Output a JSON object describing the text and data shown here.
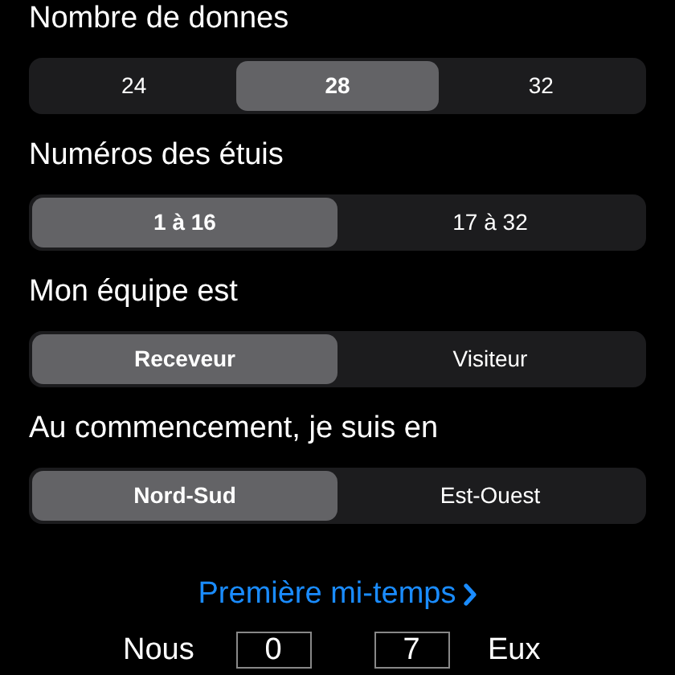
{
  "sections": [
    {
      "label": "Nombre de donnes",
      "options": [
        {
          "label": "24",
          "selected": false
        },
        {
          "label": "28",
          "selected": true
        },
        {
          "label": "32",
          "selected": false
        }
      ]
    },
    {
      "label": "Numéros des étuis",
      "options": [
        {
          "label": "1 à 16",
          "selected": true
        },
        {
          "label": "17 à 32",
          "selected": false
        }
      ]
    },
    {
      "label": "Mon équipe est",
      "options": [
        {
          "label": "Receveur",
          "selected": true
        },
        {
          "label": "Visiteur",
          "selected": false
        }
      ]
    },
    {
      "label": "Au commencement, je suis en",
      "options": [
        {
          "label": "Nord-Sud",
          "selected": true
        },
        {
          "label": "Est-Ouest",
          "selected": false
        }
      ]
    }
  ],
  "half_link": "Première mi-temps",
  "score": {
    "us_label": "Nous",
    "us_value": "0",
    "them_value": "7",
    "them_label": "Eux"
  }
}
